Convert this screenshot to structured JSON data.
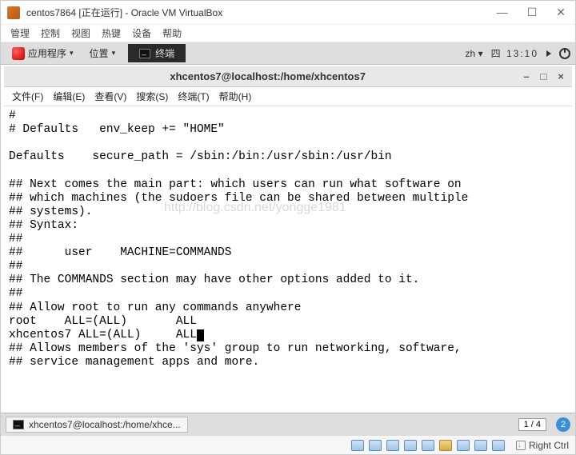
{
  "vb": {
    "title": "centos7864 [正在运行] - Oracle VM VirtualBox",
    "menu": [
      "管理",
      "控制",
      "视图",
      "热键",
      "设备",
      "帮助"
    ],
    "status_key": "Right Ctrl"
  },
  "panel": {
    "apps": "应用程序",
    "places": "位置",
    "terminal_tab": "终端",
    "lang": "zh",
    "day": "四",
    "clock": "13:10"
  },
  "terminal": {
    "title": "xhcentos7@localhost:/home/xhcentos7",
    "menu": {
      "file": "文件(F)",
      "edit": "编辑(E)",
      "view": "查看(V)",
      "search": "搜索(S)",
      "terminal": "终端(T)",
      "help": "帮助(H)"
    },
    "lines": {
      "l0": "#",
      "l1": "# Defaults   env_keep += \"HOME\"",
      "l2": "",
      "l3": "Defaults    secure_path = /sbin:/bin:/usr/sbin:/usr/bin",
      "l4": "",
      "l5": "## Next comes the main part: which users can run what software on",
      "l6": "## which machines (the sudoers file can be shared between multiple",
      "l7": "## systems).",
      "l8": "## Syntax:",
      "l9": "##",
      "l10": "##      user    MACHINE=COMMANDS",
      "l11": "##",
      "l12": "## The COMMANDS section may have other options added to it.",
      "l13": "##",
      "l14": "## Allow root to run any commands anywhere",
      "l15": "root    ALL=(ALL)       ALL",
      "l16a": "xhcentos7 ALL=(ALL)     AL",
      "l16b": "L",
      "l17": "## Allows members of the 'sys' group to run networking, software,",
      "l18": "## service management apps and more."
    },
    "watermark": "http://blog.csdn.net/yongge1981"
  },
  "taskbar": {
    "item": "xhcentos7@localhost:/home/xhce...",
    "workspace": "1 / 4",
    "badge": "2"
  }
}
